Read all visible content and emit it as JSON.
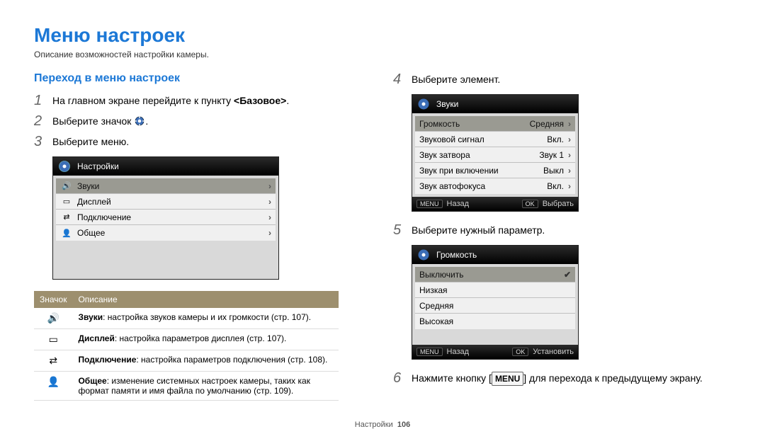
{
  "title": "Меню настроек",
  "subtitle": "Описание возможностей настройки камеры.",
  "section": "Переход в меню настроек",
  "steps": {
    "s1a": "На главном экране перейдите к пункту ",
    "s1b": "<Базовое>",
    "s1c": ".",
    "s2": "Выберите значок ",
    "s2b": ".",
    "s3": "Выберите меню.",
    "s4": "Выберите элемент.",
    "s5": "Выберите нужный параметр.",
    "s6a": "Нажмите кнопку [",
    "s6b": "MENU",
    "s6c": "] для перехода к предыдущему экрану."
  },
  "panel1": {
    "header": "Настройки",
    "rows": [
      {
        "icon": "sound",
        "label": "Звуки"
      },
      {
        "icon": "display",
        "label": "Дисплей"
      },
      {
        "icon": "connect",
        "label": "Подключение"
      },
      {
        "icon": "general",
        "label": "Общее"
      }
    ]
  },
  "tableHeader": {
    "icon": "Значок",
    "desc": "Описание"
  },
  "table": [
    {
      "icon": "sound",
      "bold": "Звуки",
      "text": ": настройка звуков камеры и их громкости (стр. 107)."
    },
    {
      "icon": "display",
      "bold": "Дисплей",
      "text": ": настройка параметров дисплея (стр. 107)."
    },
    {
      "icon": "connect",
      "bold": "Подключение",
      "text": ": настройка параметров подключения (стр. 108)."
    },
    {
      "icon": "general",
      "bold": "Общее",
      "text": ": изменение системных настроек камеры, таких как формат памяти и имя файла по умолчанию (стр. 109)."
    }
  ],
  "panel2": {
    "header": "Звуки",
    "rows": [
      {
        "label": "Громкость",
        "val": "Средняя",
        "sel": true,
        "chev": true
      },
      {
        "label": "Звуковой сигнал",
        "val": "Вкл.",
        "chev": true
      },
      {
        "label": "Звук затвора",
        "val": "Звук 1",
        "chev": true
      },
      {
        "label": "Звук при включении",
        "val": "Выкл",
        "chev": true
      },
      {
        "label": "Звук автофокуса",
        "val": "Вкл.",
        "chev": true
      }
    ],
    "ftr": {
      "backBtn": "MENU",
      "back": "Назад",
      "okBtn": "OK",
      "ok": "Выбрать"
    }
  },
  "panel3": {
    "header": "Громкость",
    "rows": [
      {
        "label": "Выключить",
        "sel": true,
        "tick": true
      },
      {
        "label": "Низкая"
      },
      {
        "label": "Средняя"
      },
      {
        "label": "Высокая"
      }
    ],
    "ftr": {
      "backBtn": "MENU",
      "back": "Назад",
      "okBtn": "OK",
      "ok": "Установить"
    }
  },
  "footer": {
    "a": "Настройки",
    "b": "106"
  }
}
